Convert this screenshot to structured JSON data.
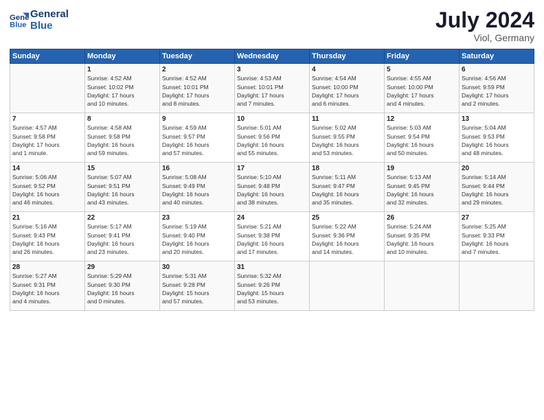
{
  "header": {
    "logo_line1": "General",
    "logo_line2": "Blue",
    "month": "July 2024",
    "location": "Viol, Germany"
  },
  "weekdays": [
    "Sunday",
    "Monday",
    "Tuesday",
    "Wednesday",
    "Thursday",
    "Friday",
    "Saturday"
  ],
  "weeks": [
    [
      {
        "day": "",
        "text": ""
      },
      {
        "day": "1",
        "text": "Sunrise: 4:52 AM\nSunset: 10:02 PM\nDaylight: 17 hours\nand 10 minutes."
      },
      {
        "day": "2",
        "text": "Sunrise: 4:52 AM\nSunset: 10:01 PM\nDaylight: 17 hours\nand 8 minutes."
      },
      {
        "day": "3",
        "text": "Sunrise: 4:53 AM\nSunset: 10:01 PM\nDaylight: 17 hours\nand 7 minutes."
      },
      {
        "day": "4",
        "text": "Sunrise: 4:54 AM\nSunset: 10:00 PM\nDaylight: 17 hours\nand 6 minutes."
      },
      {
        "day": "5",
        "text": "Sunrise: 4:55 AM\nSunset: 10:00 PM\nDaylight: 17 hours\nand 4 minutes."
      },
      {
        "day": "6",
        "text": "Sunrise: 4:56 AM\nSunset: 9:59 PM\nDaylight: 17 hours\nand 2 minutes."
      }
    ],
    [
      {
        "day": "7",
        "text": "Sunrise: 4:57 AM\nSunset: 9:58 PM\nDaylight: 17 hours\nand 1 minute."
      },
      {
        "day": "8",
        "text": "Sunrise: 4:58 AM\nSunset: 9:58 PM\nDaylight: 16 hours\nand 59 minutes."
      },
      {
        "day": "9",
        "text": "Sunrise: 4:59 AM\nSunset: 9:57 PM\nDaylight: 16 hours\nand 57 minutes."
      },
      {
        "day": "10",
        "text": "Sunrise: 5:01 AM\nSunset: 9:56 PM\nDaylight: 16 hours\nand 55 minutes."
      },
      {
        "day": "11",
        "text": "Sunrise: 5:02 AM\nSunset: 9:55 PM\nDaylight: 16 hours\nand 53 minutes."
      },
      {
        "day": "12",
        "text": "Sunrise: 5:03 AM\nSunset: 9:54 PM\nDaylight: 16 hours\nand 50 minutes."
      },
      {
        "day": "13",
        "text": "Sunrise: 5:04 AM\nSunset: 9:53 PM\nDaylight: 16 hours\nand 48 minutes."
      }
    ],
    [
      {
        "day": "14",
        "text": "Sunrise: 5:06 AM\nSunset: 9:52 PM\nDaylight: 16 hours\nand 46 minutes."
      },
      {
        "day": "15",
        "text": "Sunrise: 5:07 AM\nSunset: 9:51 PM\nDaylight: 16 hours\nand 43 minutes."
      },
      {
        "day": "16",
        "text": "Sunrise: 5:08 AM\nSunset: 9:49 PM\nDaylight: 16 hours\nand 40 minutes."
      },
      {
        "day": "17",
        "text": "Sunrise: 5:10 AM\nSunset: 9:48 PM\nDaylight: 16 hours\nand 38 minutes."
      },
      {
        "day": "18",
        "text": "Sunrise: 5:11 AM\nSunset: 9:47 PM\nDaylight: 16 hours\nand 35 minutes."
      },
      {
        "day": "19",
        "text": "Sunrise: 5:13 AM\nSunset: 9:45 PM\nDaylight: 16 hours\nand 32 minutes."
      },
      {
        "day": "20",
        "text": "Sunrise: 5:14 AM\nSunset: 9:44 PM\nDaylight: 16 hours\nand 29 minutes."
      }
    ],
    [
      {
        "day": "21",
        "text": "Sunrise: 5:16 AM\nSunset: 9:43 PM\nDaylight: 16 hours\nand 26 minutes."
      },
      {
        "day": "22",
        "text": "Sunrise: 5:17 AM\nSunset: 9:41 PM\nDaylight: 16 hours\nand 23 minutes."
      },
      {
        "day": "23",
        "text": "Sunrise: 5:19 AM\nSunset: 9:40 PM\nDaylight: 16 hours\nand 20 minutes."
      },
      {
        "day": "24",
        "text": "Sunrise: 5:21 AM\nSunset: 9:38 PM\nDaylight: 16 hours\nand 17 minutes."
      },
      {
        "day": "25",
        "text": "Sunrise: 5:22 AM\nSunset: 9:36 PM\nDaylight: 16 hours\nand 14 minutes."
      },
      {
        "day": "26",
        "text": "Sunrise: 5:24 AM\nSunset: 9:35 PM\nDaylight: 16 hours\nand 10 minutes."
      },
      {
        "day": "27",
        "text": "Sunrise: 5:25 AM\nSunset: 9:33 PM\nDaylight: 16 hours\nand 7 minutes."
      }
    ],
    [
      {
        "day": "28",
        "text": "Sunrise: 5:27 AM\nSunset: 9:31 PM\nDaylight: 16 hours\nand 4 minutes."
      },
      {
        "day": "29",
        "text": "Sunrise: 5:29 AM\nSunset: 9:30 PM\nDaylight: 16 hours\nand 0 minutes."
      },
      {
        "day": "30",
        "text": "Sunrise: 5:31 AM\nSunset: 9:28 PM\nDaylight: 15 hours\nand 57 minutes."
      },
      {
        "day": "31",
        "text": "Sunrise: 5:32 AM\nSunset: 9:26 PM\nDaylight: 15 hours\nand 53 minutes."
      },
      {
        "day": "",
        "text": ""
      },
      {
        "day": "",
        "text": ""
      },
      {
        "day": "",
        "text": ""
      }
    ]
  ]
}
